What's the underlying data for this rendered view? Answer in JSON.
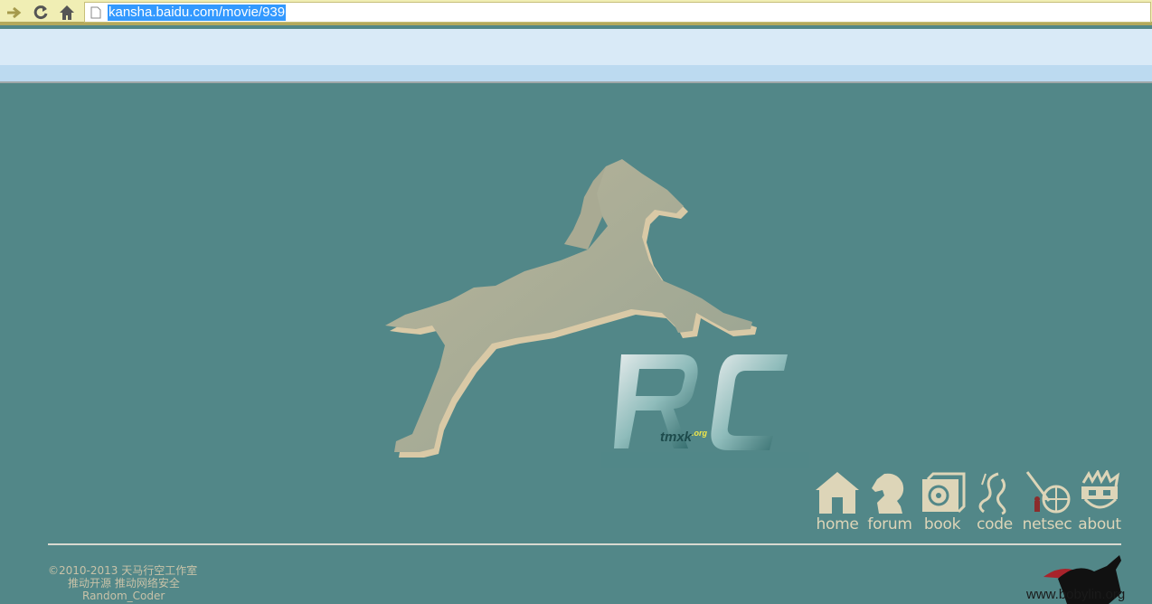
{
  "browser": {
    "url": "kansha.baidu.com/movie/939",
    "icons": [
      "forward-icon",
      "reload-icon",
      "home-icon",
      "page-icon"
    ]
  },
  "logo": {
    "letters": "RC",
    "site": "tmxk",
    "tld": ".org"
  },
  "nav": {
    "items": [
      {
        "label": "home",
        "icon": "house-icon"
      },
      {
        "label": "forum",
        "icon": "chess-knight-icon"
      },
      {
        "label": "book",
        "icon": "books-icon"
      },
      {
        "label": "code",
        "icon": "code-glyph-icon"
      },
      {
        "label": "netsec",
        "icon": "globe-antenna-icon"
      },
      {
        "label": "about",
        "icon": "face-icon"
      }
    ]
  },
  "footer": {
    "line1": "©2010-2013  天马行空工作室",
    "line2": "推动开源    推动网络安全",
    "line3": "Random_Coder"
  },
  "corner": {
    "watermark": "www.bobylin.org"
  },
  "colors": {
    "page_bg": "#528788",
    "accent": "#ddd5b8",
    "toolbar": "#f0eeb4"
  }
}
